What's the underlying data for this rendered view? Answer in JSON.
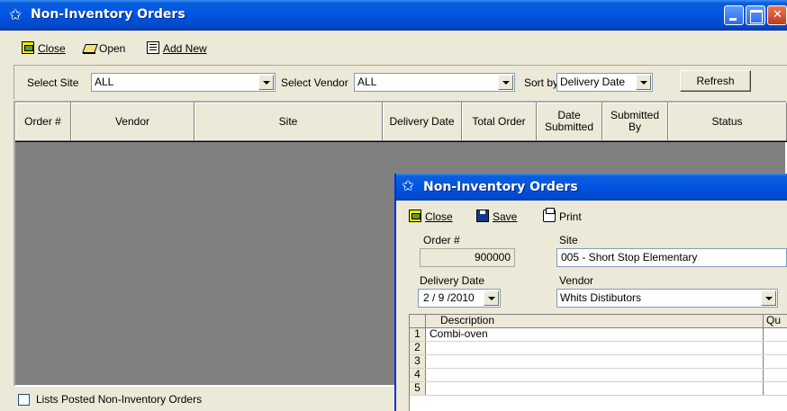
{
  "main_window": {
    "title": "Non-Inventory Orders",
    "toolbar": {
      "close_label": "Close",
      "open_label": "Open",
      "add_new_label": "Add New"
    },
    "filters": {
      "site_label": "Select Site",
      "site_value": "ALL",
      "vendor_label": "Select Vendor",
      "vendor_value": "ALL",
      "sort_label": "Sort by",
      "sort_value": "Delivery Date",
      "refresh_label": "Refresh"
    },
    "grid": {
      "columns": [
        "Order #",
        "Vendor",
        "Site",
        "Delivery Date",
        "Total Order",
        "Date Submitted",
        "Submitted By",
        "Status"
      ]
    },
    "posted_checkbox_label": "Lists Posted Non-Inventory Orders",
    "posted_checked": false
  },
  "dialog": {
    "title": "Non-Inventory Orders",
    "toolbar": {
      "close_label": "Close",
      "save_label": "Save",
      "print_label": "Print"
    },
    "order_label": "Order #",
    "order_value": "900000",
    "site_label": "Site",
    "site_value": "005 - Short Stop Elementary",
    "delivery_label": "Delivery Date",
    "delivery_value": "2 / 9 /2010",
    "vendor_label": "Vendor",
    "vendor_value": "Whits Distibutors",
    "items": {
      "description_header": "Description",
      "quantity_header": "Qu",
      "rows": [
        {
          "num": "1",
          "description": "Combi-oven"
        },
        {
          "num": "2",
          "description": ""
        },
        {
          "num": "3",
          "description": ""
        },
        {
          "num": "4",
          "description": ""
        },
        {
          "num": "5",
          "description": ""
        }
      ]
    }
  },
  "colors": {
    "title_bar": "#0054e3",
    "window_face": "#ece9d8",
    "grid_empty": "#808080"
  }
}
